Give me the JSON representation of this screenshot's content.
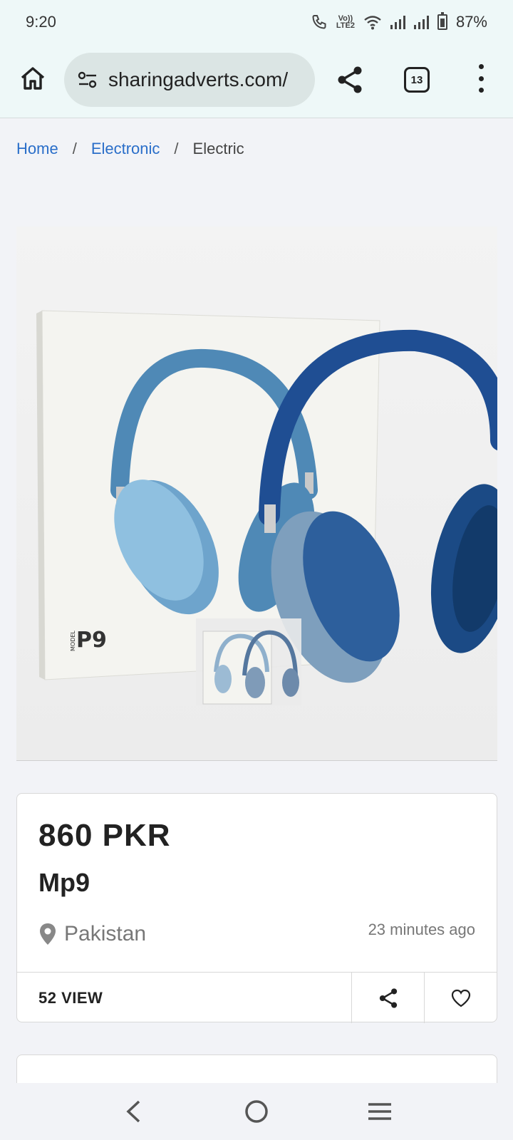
{
  "status_bar": {
    "time": "9:20",
    "lte_top": "Vo))",
    "lte_bottom": "LTE2",
    "battery": "87%"
  },
  "browser": {
    "url": "sharingadverts.com/",
    "tab_count": "13"
  },
  "breadcrumb": {
    "home": "Home",
    "sep1": "/",
    "category": "Electronic",
    "sep2": "/",
    "current": "Electric"
  },
  "product": {
    "box_brand_small": "MODEL",
    "box_brand": "P9",
    "price": "860 PKR",
    "title": "Mp9",
    "location": "Pakistan",
    "posted": "23 minutes ago",
    "views": "52 VIEW"
  },
  "colors": {
    "link": "#2a6ec9",
    "headphone_light": "#5b8fb8",
    "headphone_dark": "#1f4e93"
  }
}
